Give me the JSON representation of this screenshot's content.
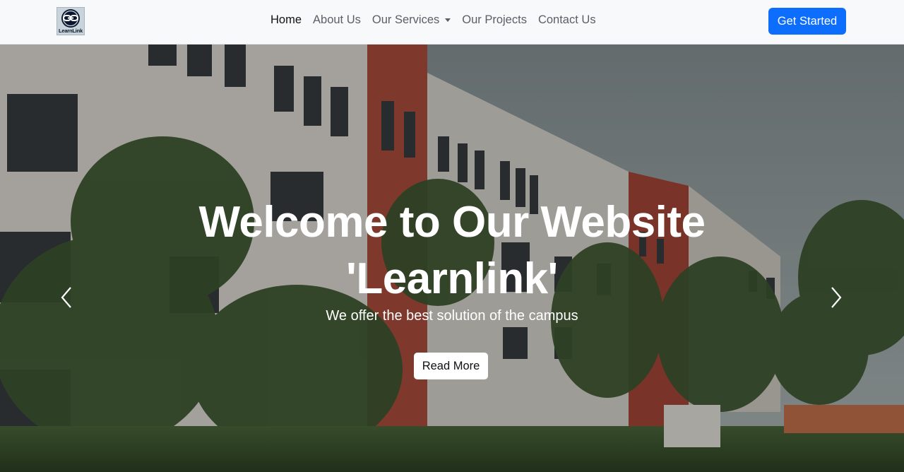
{
  "brand": {
    "logo_text": "LearnLink",
    "logo_icon": "chain-link-icon"
  },
  "nav": {
    "items": [
      {
        "label": "Home",
        "active": true
      },
      {
        "label": "About Us"
      },
      {
        "label": "Our Services",
        "dropdown": true
      },
      {
        "label": "Our Projects"
      },
      {
        "label": "Contact Us"
      }
    ],
    "cta_label": "Get Started"
  },
  "hero": {
    "title_line1": "Welcome to Our Website",
    "title_line2": "'Learnlink'",
    "subtitle": "We offer the best solution of the campus",
    "button_label": "Read More",
    "prev_icon": "chevron-left-icon",
    "next_icon": "chevron-right-icon"
  },
  "colors": {
    "primary": "#0d6efd",
    "navbar_bg": "#f8f9fa",
    "hero_text": "#ffffff"
  }
}
